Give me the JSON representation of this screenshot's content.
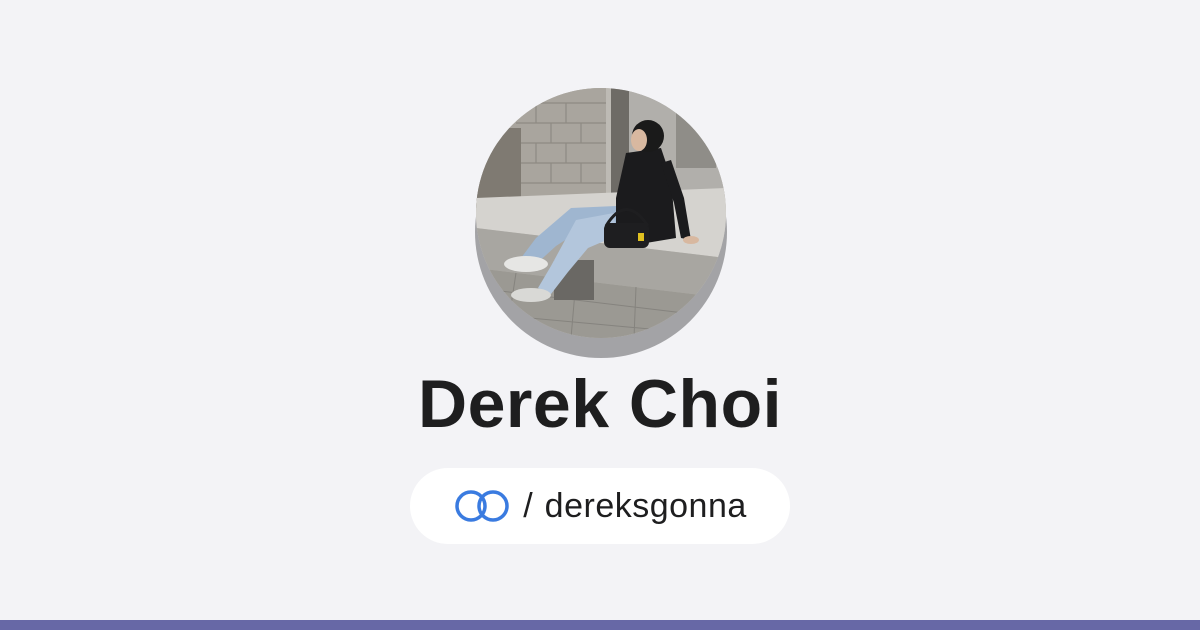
{
  "profile": {
    "name": "Derek Choi",
    "separator": "/",
    "handle": "dereksgonna",
    "link_icon": "linked-rings-icon"
  },
  "colors": {
    "background": "#f3f3f6",
    "bottom_bar": "#6768a6",
    "icon_blue": "#3a7be0",
    "text": "#1e1e1f"
  }
}
